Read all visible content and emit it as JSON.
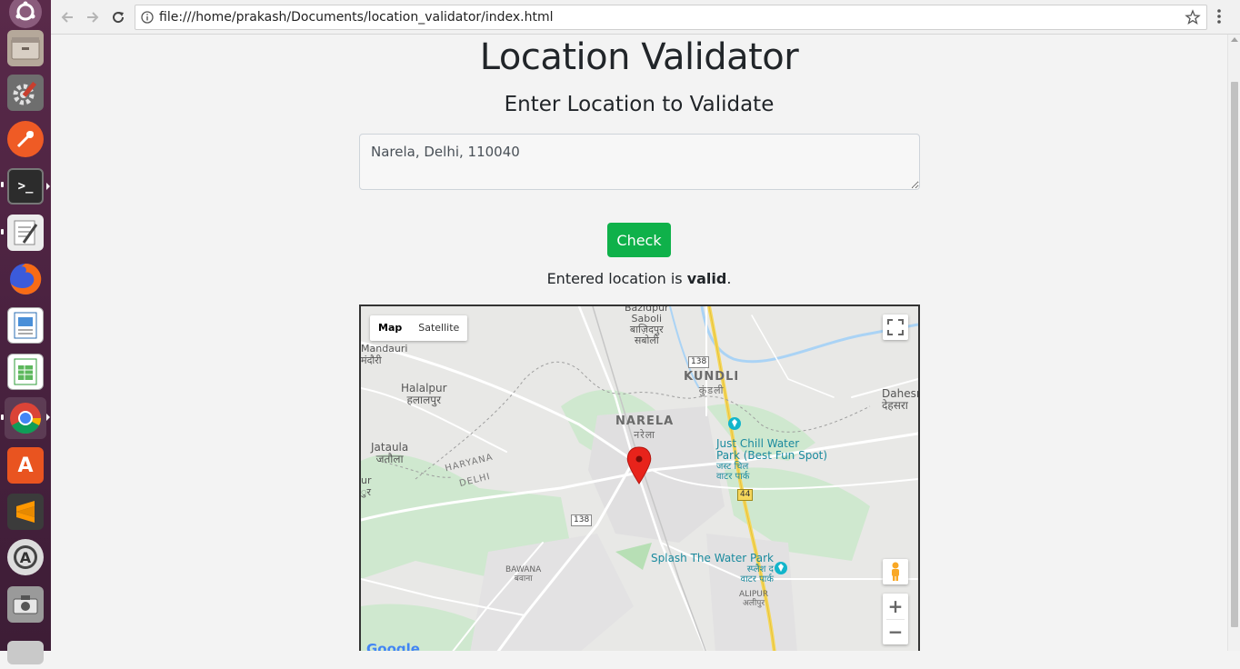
{
  "browser": {
    "url": "file:///home/prakash/Documents/location_validator/index.html"
  },
  "page": {
    "title": "Location Validator",
    "subtitle": "Enter Location to Validate",
    "location_value": "Narela, Delhi, 110040",
    "check_label": "Check",
    "result_prefix": "Entered location is ",
    "result_status": "valid",
    "result_suffix": "."
  },
  "map": {
    "type_map": "Map",
    "type_satellite": "Satellite",
    "zoom_in": "+",
    "zoom_out": "−",
    "places": {
      "bazidpur": [
        "Bazidpur",
        "Saboli",
        "बाज़िदपुर",
        "सबोली"
      ],
      "mandauri": [
        "Mandauri",
        "मंदौरी"
      ],
      "halalpur": [
        "Halalpur",
        "हलालपुर"
      ],
      "jataula": [
        "Jataula",
        "जतौला"
      ],
      "kundli": [
        "KUNDLI",
        "कुंडली"
      ],
      "narela": [
        "NARELA",
        "नरेला"
      ],
      "dahesra": [
        "Dahesr",
        "देहसरा"
      ],
      "haryana": "HARYANA",
      "delhi": "DELHI",
      "justchill": [
        "Just Chill Water",
        "Park (Best Fun Spot)",
        "जस्ट चिल",
        "वाटर पार्क"
      ],
      "splash": [
        "Splash The Water Park",
        "स्प्लैश द",
        "वाटर पार्क"
      ],
      "bawana": [
        "BAWANA",
        "बवाना"
      ],
      "alipur": [
        "ALIPUR",
        "अलीपुर"
      ],
      "ur": [
        "ur",
        "ुर"
      ],
      "google": "Google"
    },
    "roads": {
      "r138a": "138",
      "r138b": "138",
      "r44": "44"
    },
    "colors": {
      "land": "#e8e8e6",
      "park": "#c8e6c9",
      "road": "#ffffff",
      "highway": "#f5d75b",
      "water": "#aad3f5",
      "pin": "#e8231b"
    }
  },
  "launcher": {
    "apps": [
      "ubuntu-icon",
      "files-icon",
      "settings-icon",
      "postman-icon",
      "terminal-icon",
      "text-editor-icon",
      "firefox-icon",
      "writer-icon",
      "calc-icon",
      "chrome-icon",
      "software-center-icon",
      "sublime-icon",
      "software-updater-icon",
      "screenshot-icon",
      "trash-icon"
    ]
  }
}
